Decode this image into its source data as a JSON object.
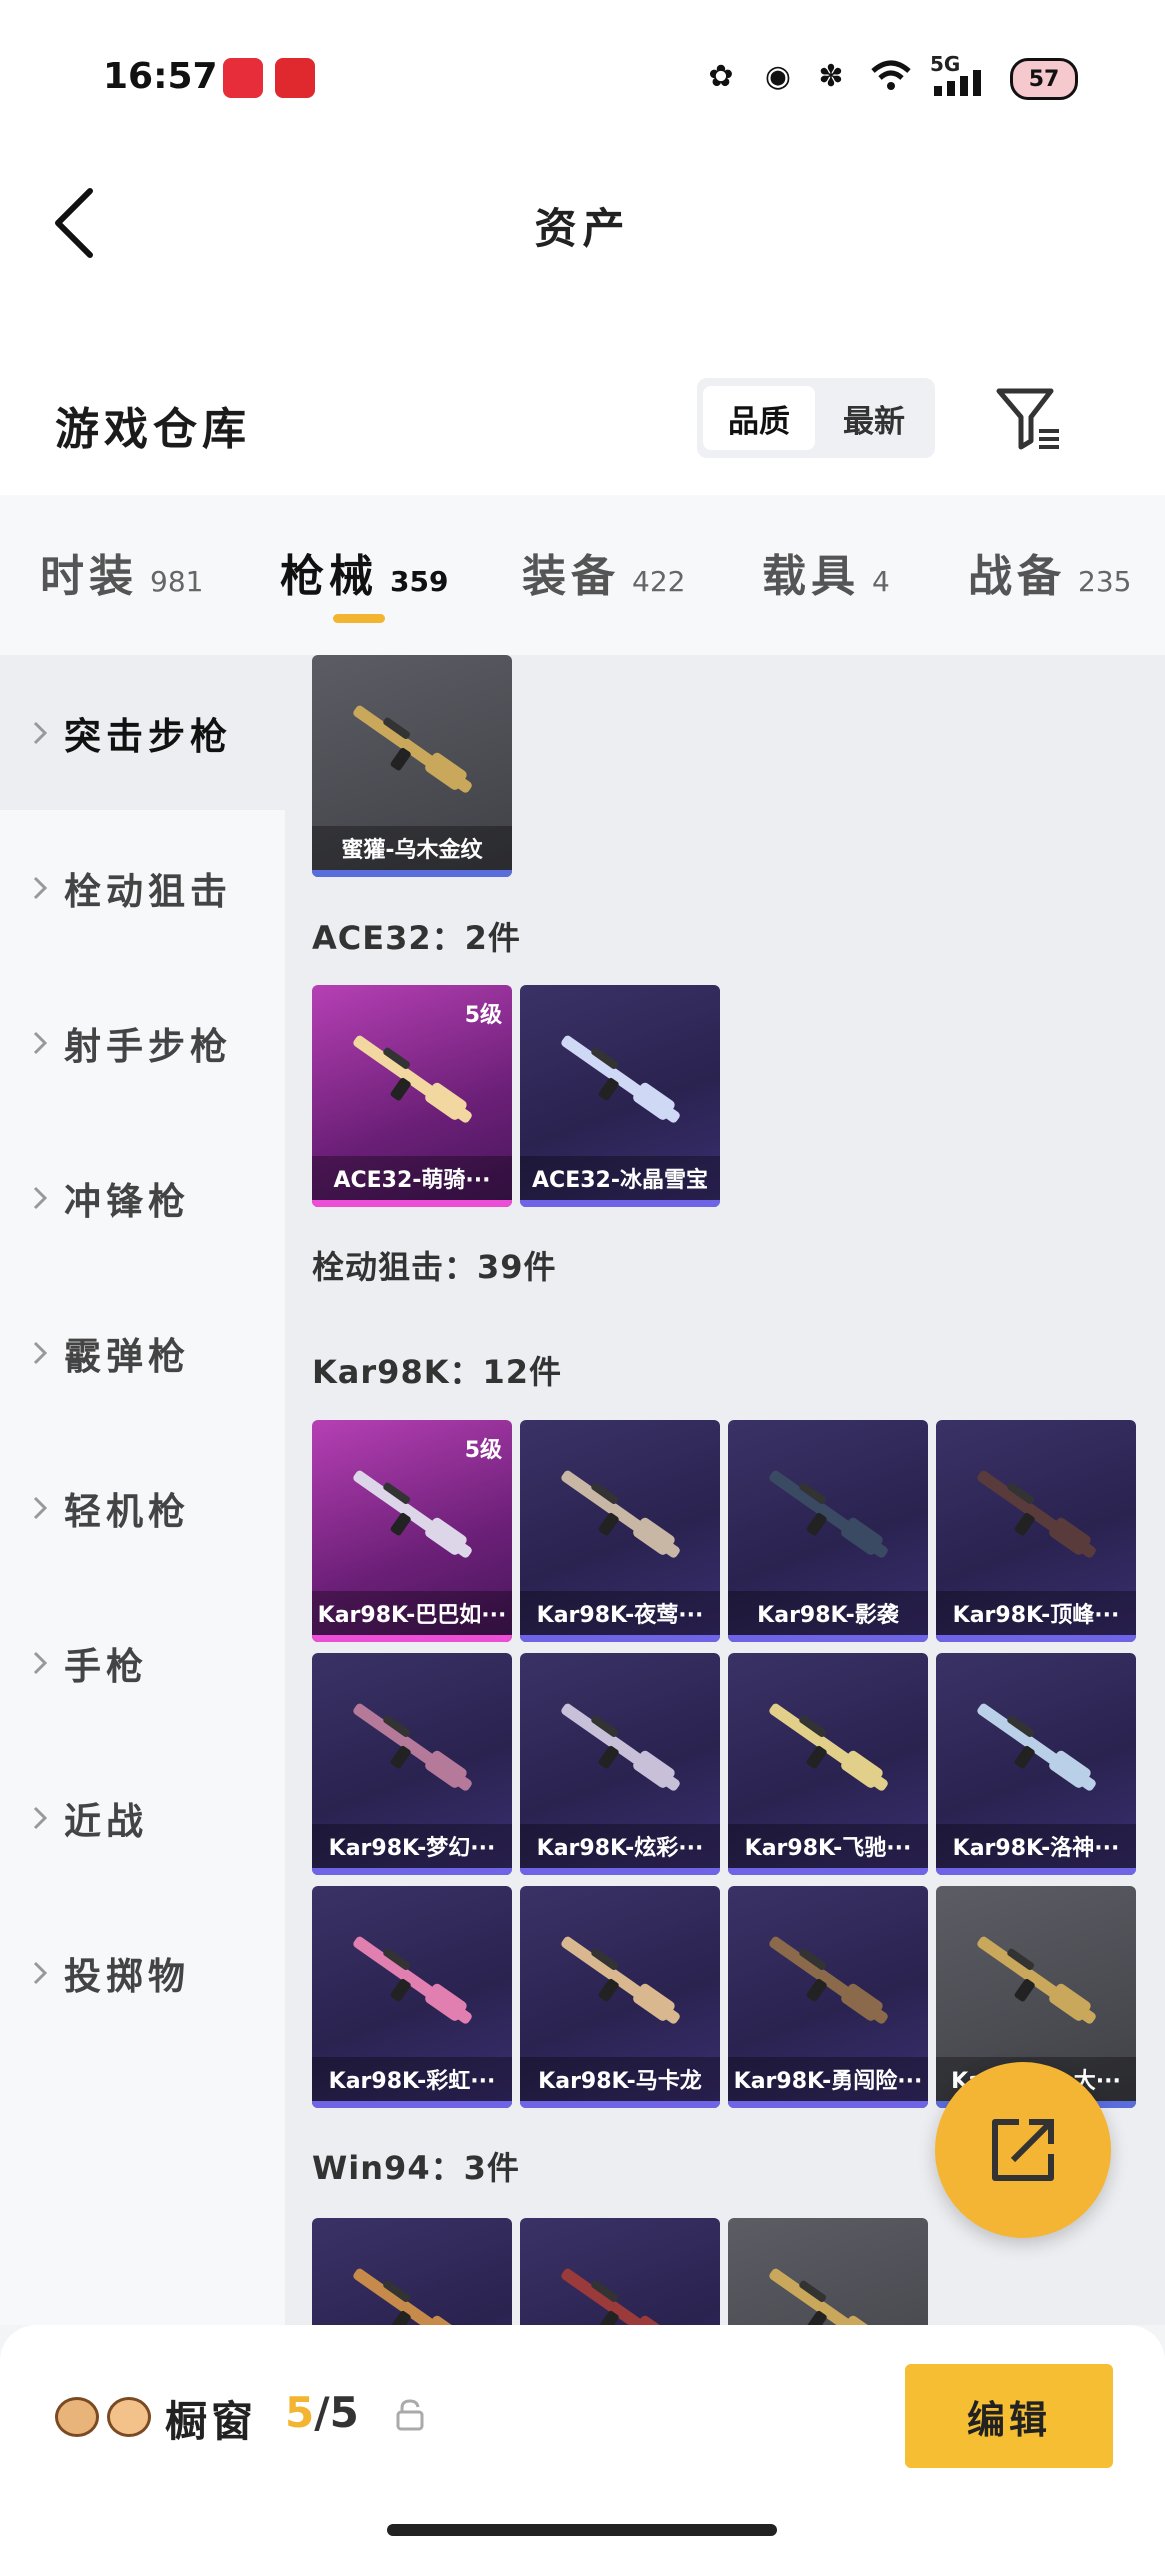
{
  "status_bar": {
    "time": "16:57",
    "network": "5G",
    "battery": "57"
  },
  "header": {
    "title": "资产"
  },
  "section": {
    "title": "游戏仓库",
    "sort_options": [
      "品质",
      "最新"
    ],
    "sort_selected": "品质"
  },
  "tabs": [
    {
      "name": "时装",
      "count": "981"
    },
    {
      "name": "枪械",
      "count": "359",
      "active": true
    },
    {
      "name": "装备",
      "count": "422"
    },
    {
      "name": "载具",
      "count": "4"
    },
    {
      "name": "战备",
      "count": "235"
    }
  ],
  "sidebar": [
    "突击步枪",
    "栓动狙击",
    "射手步枪",
    "冲锋枪",
    "霰弹枪",
    "轻机枪",
    "手枪",
    "近战",
    "投掷物"
  ],
  "content": {
    "top_card": "蜜獾-乌木金纹",
    "ace_header": "ACE32：2件",
    "ace_items": [
      {
        "label": "ACE32-萌骑···",
        "level": "5级"
      },
      {
        "label": "ACE32-冰晶雪宝"
      }
    ],
    "bolt_header": "栓动狙击：39件",
    "kar_header": "Kar98K：12件",
    "kar_items": [
      {
        "label": "Kar98K-巴巴如···",
        "level": "5级"
      },
      {
        "label": "Kar98K-夜莺···"
      },
      {
        "label": "Kar98K-影袭"
      },
      {
        "label": "Kar98K-顶峰···"
      },
      {
        "label": "Kar98K-梦幻···"
      },
      {
        "label": "Kar98K-炫彩···"
      },
      {
        "label": "Kar98K-飞驰···"
      },
      {
        "label": "Kar98K-洛神···"
      },
      {
        "label": "Kar98K-彩虹···"
      },
      {
        "label": "Kar98K-马卡龙"
      },
      {
        "label": "Kar98K-勇闯险···"
      },
      {
        "label": "Kar98K-···大···"
      }
    ],
    "win_header": "Win94：3件"
  },
  "bottom": {
    "showcase": "橱窗",
    "count_current": "5",
    "count_total": "/5",
    "edit_label": "编辑"
  },
  "colors": {
    "accent": "#f3b431",
    "purple_card": "#2a2350",
    "pink_card": "#6b1f77"
  }
}
